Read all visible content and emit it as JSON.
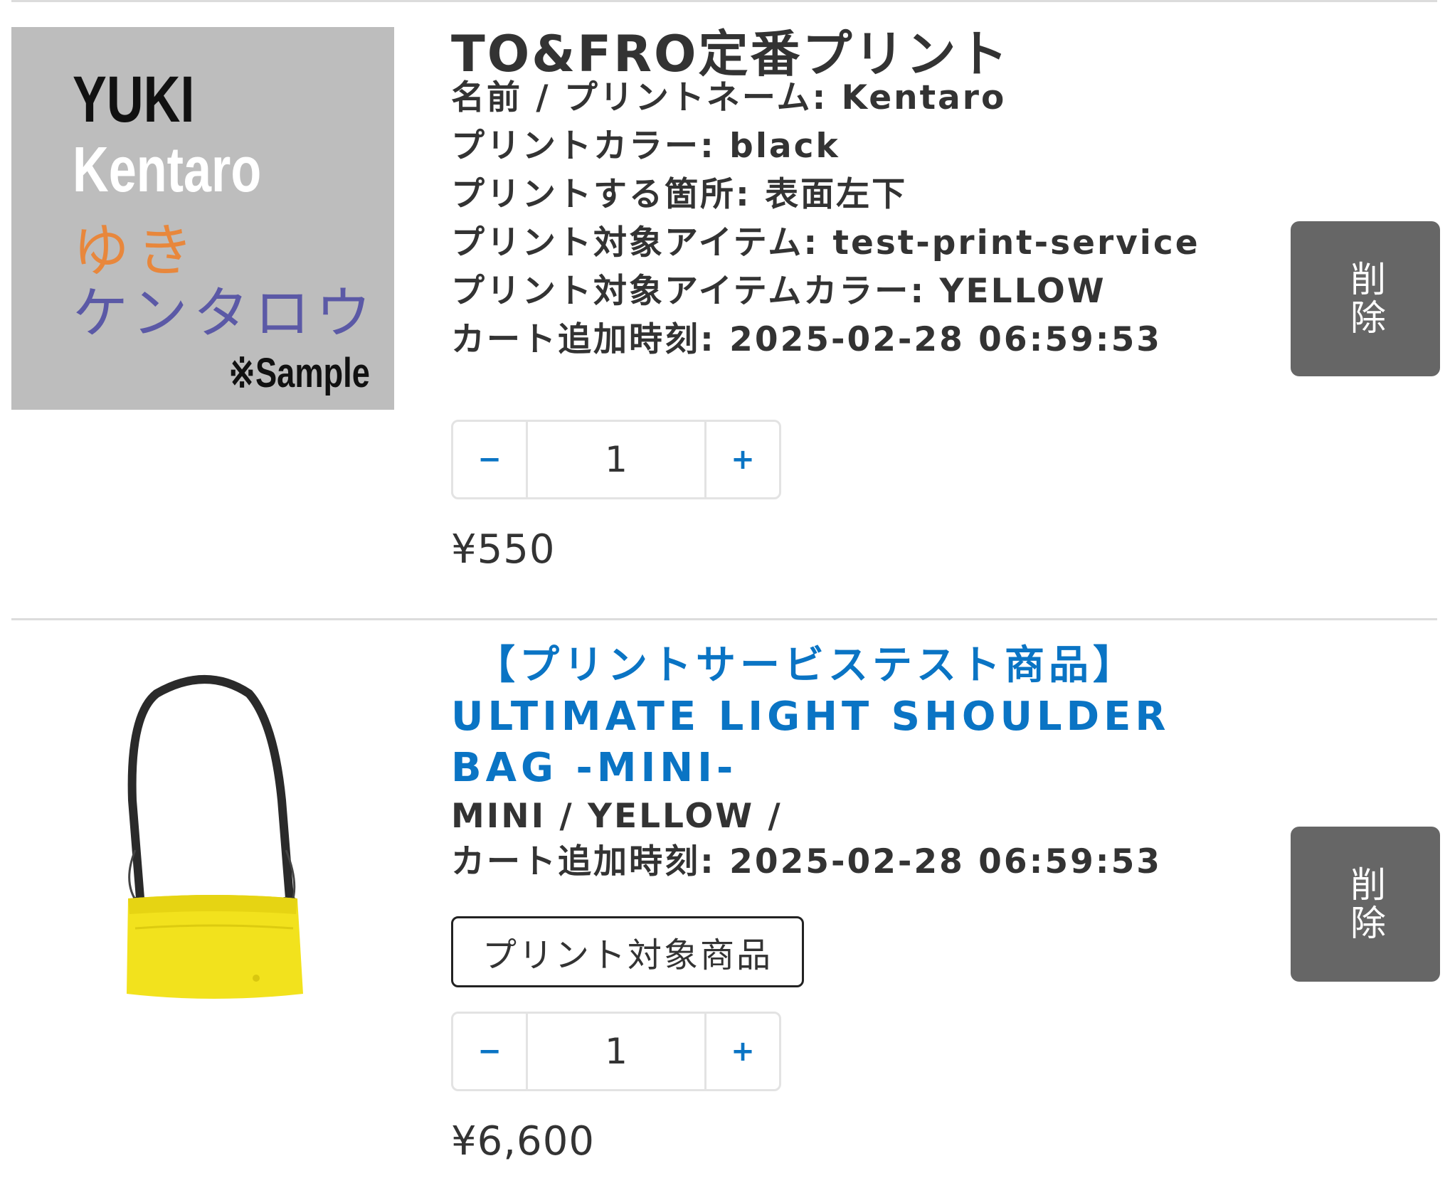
{
  "items": [
    {
      "title": "TO&FRO定番プリント",
      "thumbnail": {
        "lines": [
          "YUKI",
          "Kentaro",
          "ゆき",
          "ケンタロウ"
        ],
        "note": "※Sample"
      },
      "meta": [
        {
          "key": "名前 / プリントネーム",
          "value": "Kentaro"
        },
        {
          "key": "プリントカラー",
          "value": "black"
        },
        {
          "key": "プリントする箇所",
          "value": "表面左下"
        },
        {
          "key": "プリント対象アイテム",
          "value": "test-print-service"
        },
        {
          "key": "プリント対象アイテムカラー",
          "value": "YELLOW"
        },
        {
          "key": "カート追加時刻",
          "value": "2025-02-28 06:59:53"
        }
      ],
      "stepper": {
        "minus": "−",
        "quantity": "1",
        "plus": "+"
      },
      "price": "¥550",
      "delete_label": "削除"
    },
    {
      "title_lines": [
        "　【プリントサービステスト商品】",
        "ULTIMATE LIGHT SHOULDER",
        "BAG -MINI-"
      ],
      "variant": "MINI / YELLOW /",
      "added_time": {
        "key": "カート追加時刻",
        "value": "2025-02-28 06:59:53"
      },
      "badge": "プリント対象商品",
      "stepper": {
        "minus": "−",
        "quantity": "1",
        "plus": "+"
      },
      "price": "¥6,600",
      "delete_label": "削除",
      "image_icon": "yellow-shoulder-bag"
    }
  ],
  "colors": {
    "link_blue": "#0a74c4",
    "delete_bg": "#666666",
    "thumb_bg": "#bdbdbd",
    "bag_yellow": "#f2e21d"
  }
}
